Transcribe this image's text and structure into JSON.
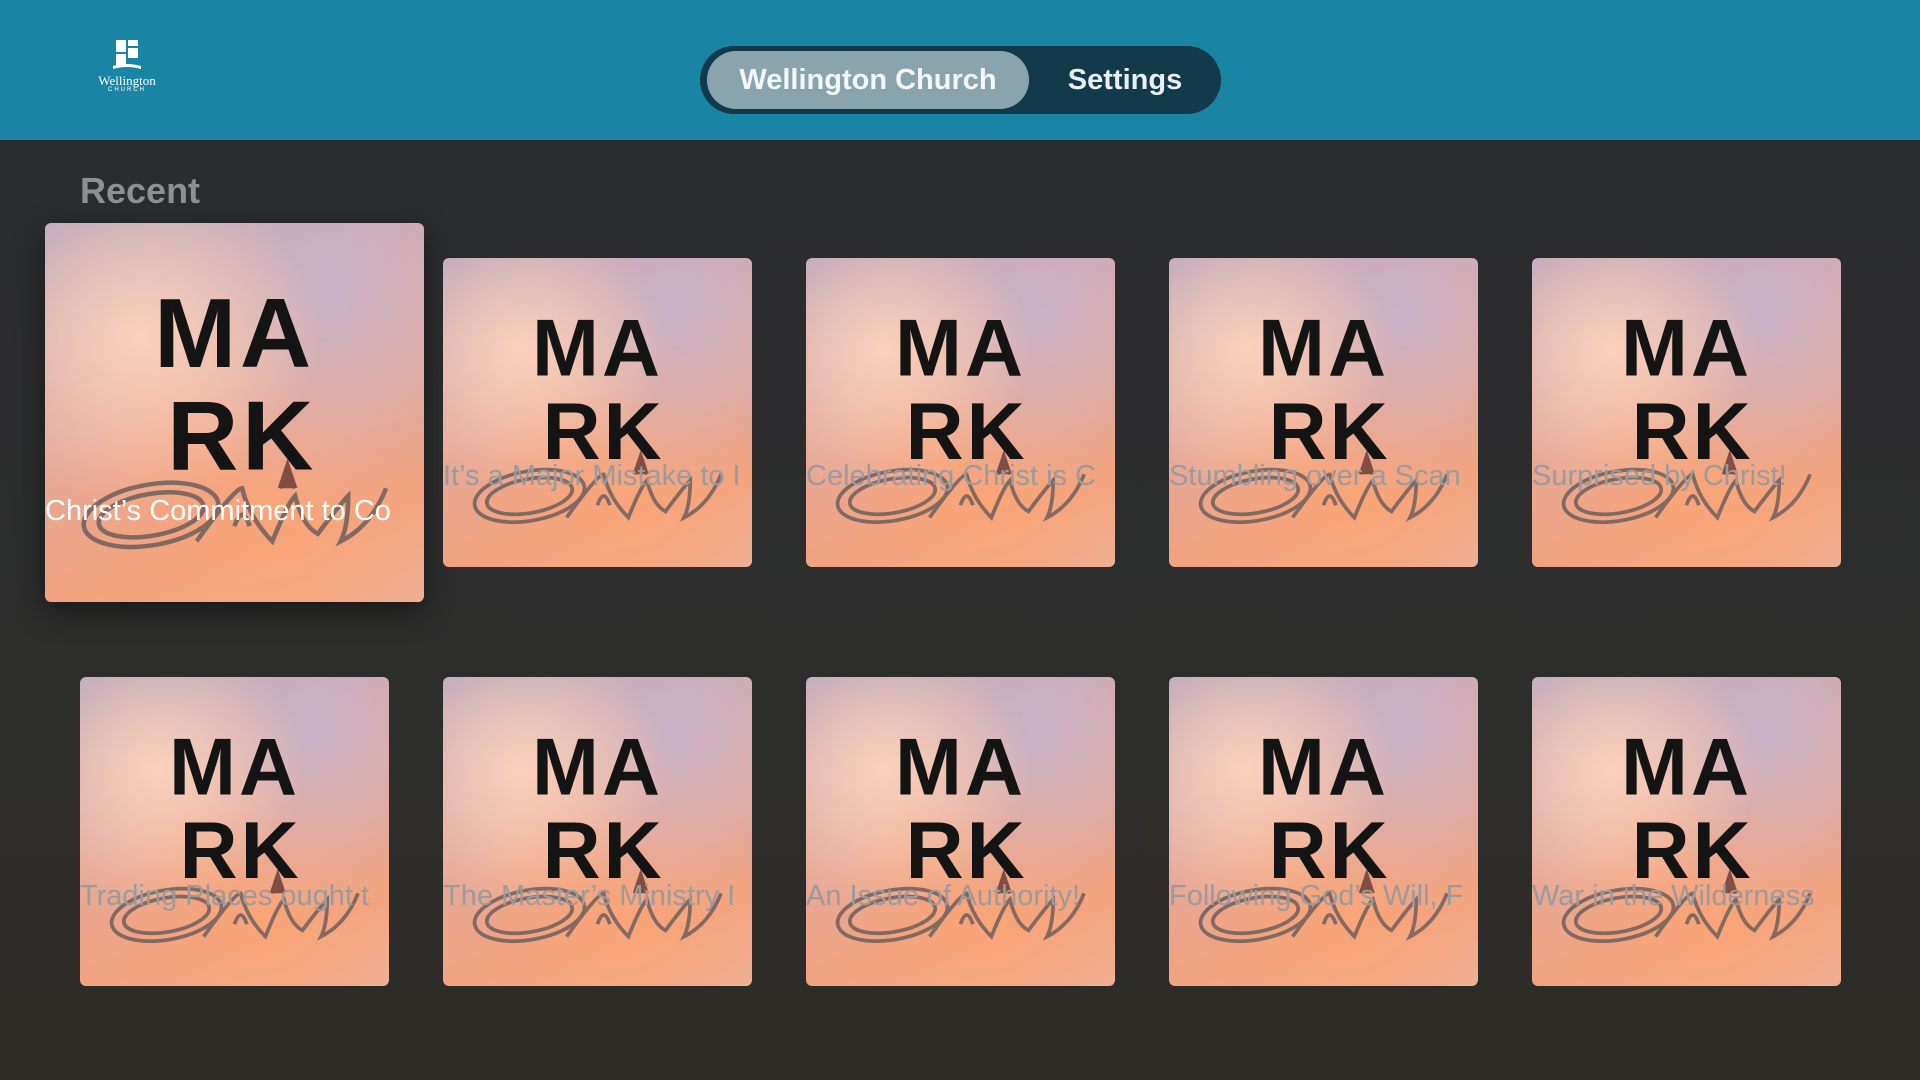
{
  "app": {
    "logo_text": "Wellington",
    "logo_subtext": "CHURCH"
  },
  "tabs": [
    {
      "label": "Wellington Church",
      "selected": true
    },
    {
      "label": "Settings",
      "selected": false
    }
  ],
  "section": {
    "title": "Recent"
  },
  "artwork": {
    "line1": "MA",
    "line2": "RK"
  },
  "items": [
    {
      "title": "Christ’s Commitment to Co",
      "focused": true
    },
    {
      "title": "It’s a Major Mistake to I"
    },
    {
      "title": "Celebrating Christ is C"
    },
    {
      "title": "Stumbling over a Scan"
    },
    {
      "title": "Surprised by Christ!"
    },
    {
      "title": "Trading Places ought t"
    },
    {
      "title": "The Master’s Ministry I"
    },
    {
      "title": "An Issue of Authority!"
    },
    {
      "title": "Following God’s Will, F"
    },
    {
      "title": "War in the Wilderness"
    }
  ],
  "colors": {
    "header": "#1a84a4",
    "tab_pill_bg": "#123a4a",
    "tab_selected": "#8aa4ae",
    "background": "#2b2c2e"
  }
}
